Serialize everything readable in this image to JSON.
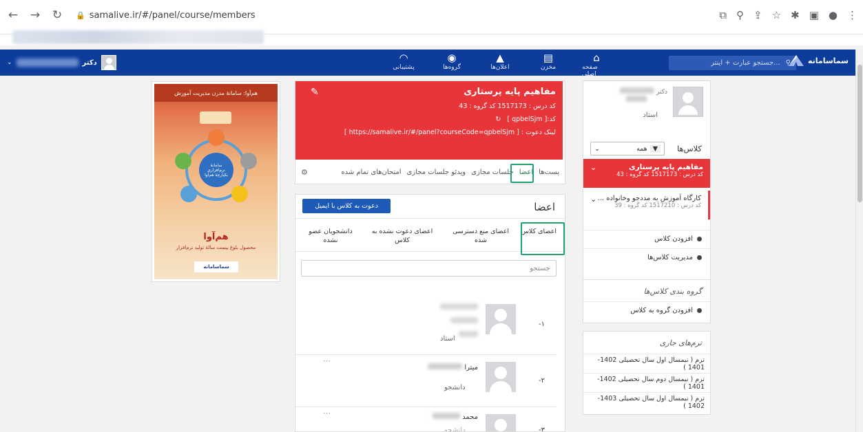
{
  "browser": {
    "url": "samalive.ir/#/panel/course/members",
    "icons": [
      "back-icon",
      "forward-icon",
      "reload-icon",
      "lock-icon",
      "install-icon",
      "zoom-icon",
      "share-icon",
      "star-icon",
      "extensions-icon",
      "sidepanel-icon",
      "profile-icon",
      "menu-icon"
    ]
  },
  "topbar": {
    "brand": "سماسامانه",
    "search_placeholder": "جستجو عبارت + اینتر...",
    "nav": [
      {
        "label": "صفحه اصلی",
        "icon": "home-icon"
      },
      {
        "label": "مخزن",
        "icon": "book-icon"
      },
      {
        "label": "اعلان‌ها",
        "icon": "bell-icon"
      },
      {
        "label": "گروه‌ها",
        "icon": "globe-icon"
      },
      {
        "label": "پشتیبانی",
        "icon": "rss-icon"
      }
    ],
    "user_title": "دکتر"
  },
  "profile": {
    "title": "دکتر",
    "role": "استاد"
  },
  "classes": {
    "header": "کلاس‌ها",
    "filter_value": "همه",
    "items": [
      {
        "title": "مفاهیم پایه پرستاری",
        "meta": "کد درس : 1517173    کد گروه : 43",
        "active": true
      },
      {
        "title": "کارگاه آموزش به مددجو وخانواده ...",
        "meta": "کد درس : 1517210    کد گروه : 39",
        "active": false
      }
    ],
    "add_class": "افزودن کلاس",
    "manage_classes": "مدیریت کلاس‌ها"
  },
  "grouping": {
    "title": "گروه بندی کلاس‌ها",
    "add_group": "افزودن گروه به کلاس"
  },
  "terms": {
    "title": "ترم‌های جاری",
    "items": [
      "ترم ( نیمسال اول سال تحصیلی 1402-1401 )",
      "ترم ( نیمسال دوم سال تحصیلی 1402-1401 )",
      "ترم ( نیمسال اول سال تحصیلی 1403-1402 )"
    ]
  },
  "course": {
    "title": "مفاهیم پایه پرستاری",
    "codes": "کد درس :  1517173    کد گروه : 43",
    "code_label": "کد:[ qpbelSjm ]",
    "invite_link": "لینک دعوت : [ https://samalive.ir/#/panel?courseCode=qpbelSjm ]",
    "tabs": [
      "پست‌ها",
      "اعضا",
      "جلسات مجازی",
      "ویدئو جلسات مجازی",
      "امتحان‌های تمام شده"
    ]
  },
  "members": {
    "title": "اعضا",
    "invite_button": "دعوت به کلاس با ایمیل",
    "subtabs": [
      "اعضای کلاس",
      "اعضای منع دسترسی شده",
      "اعضای دعوت نشده به کلاس",
      "دانشجویان عضو نشده"
    ],
    "search_placeholder": "جستجو",
    "rows": [
      {
        "index": "-۱",
        "name": "",
        "role": "استاد"
      },
      {
        "index": "-۲",
        "name": "میترا",
        "role": "دانشجو"
      },
      {
        "index": "-۳",
        "name": "محمد",
        "role": "دانشجو"
      }
    ]
  },
  "poster": {
    "header": "هم‌آوا: سامانهٔ مدرن مدیریت آموزش",
    "title": "هم‌آوا",
    "subtitle": "محصول بلوغ بیست سالهٔ تولید نرم‌افزار",
    "center": "سامانهٔ نرم‌افزاری یکپارچهٔ هم‌آوا",
    "footer_logo": "سماسامانه"
  }
}
